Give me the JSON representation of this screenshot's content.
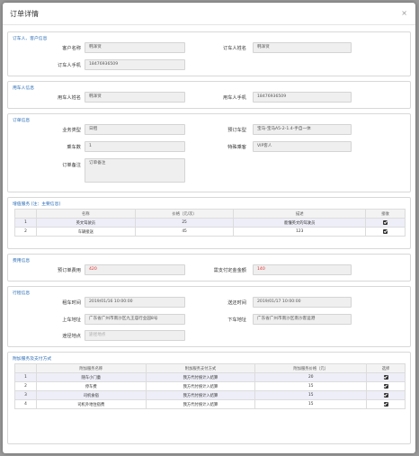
{
  "dialog": {
    "title": "订单详情",
    "close": "×"
  },
  "customer": {
    "title": "订车人、客户信息",
    "customer_name_label": "客户名称",
    "customer_name": "韩泽贤",
    "booker_name_label": "订车人姓名",
    "booker_name": "韩泽贤",
    "booker_phone_label": "订车人手机",
    "booker_phone": "18476936509"
  },
  "passenger": {
    "title": "用车人信息",
    "name_label": "用车人姓名",
    "name": "韩泽贤",
    "phone_label": "用车人手机",
    "phone": "18476936509"
  },
  "order": {
    "title": "订单信息",
    "business_type_label": "业务类型",
    "business_type": "日租",
    "vehicle_label": "预订车型",
    "vehicle": "宝马-宝马A5-2-1.4-手自一体",
    "car_count_label": "乘车数",
    "car_count": "1",
    "special_label": "特殊乘客",
    "special": "VIP客人",
    "note_label": "订单备注",
    "note": "订单备注"
  },
  "services": {
    "title": "增值服务",
    "title_hint": "(注：主要信息)",
    "headers": [
      "",
      "名称",
      "价格（元/次）",
      "描述",
      "接收"
    ],
    "rows": [
      {
        "num": "1",
        "name": "英文驾驶员",
        "price": "25",
        "desc": "能懂英文的驾驶员"
      },
      {
        "num": "2",
        "name": "车辆接送",
        "price": "45",
        "desc": "123"
      }
    ]
  },
  "fees": {
    "title": "费用信息",
    "booking_fee_label": "预订单费用",
    "booking_fee": "420",
    "deposit_label": "需支付定金金额",
    "deposit": "140"
  },
  "trip": {
    "title": "行程信息",
    "rent_time_label": "租车时间",
    "rent_time": "2019/01/16 10:00:00",
    "return_time_label": "送还时间",
    "return_time": "2019/01/17 10:00:00",
    "pickup_label": "上车地址",
    "pickup": "广东省广州市南沙区九王庙行业园8号",
    "dropoff_label": "下车地址",
    "dropoff": "广东省广州市南沙区南沙客运港",
    "via_label": "途径地点",
    "via_placeholder": "途径地点"
  },
  "extras": {
    "title": "附加服务及支付方式",
    "headers": [
      "",
      "附加服务名称",
      "附加服务支付方式",
      "附加服务价格（元）",
      "选择"
    ],
    "rows": [
      {
        "num": "1",
        "name": "随车小门童",
        "pay": "我方代付统计入结算",
        "price": "20"
      },
      {
        "num": "2",
        "name": "停车费",
        "pay": "我方代付统计入结算",
        "price": "15"
      },
      {
        "num": "3",
        "name": "司机食宿",
        "pay": "我方代付统计入结算",
        "price": "15"
      },
      {
        "num": "4",
        "name": "司机外地住宿费",
        "pay": "我方代付统计入结算",
        "price": "15"
      }
    ]
  }
}
